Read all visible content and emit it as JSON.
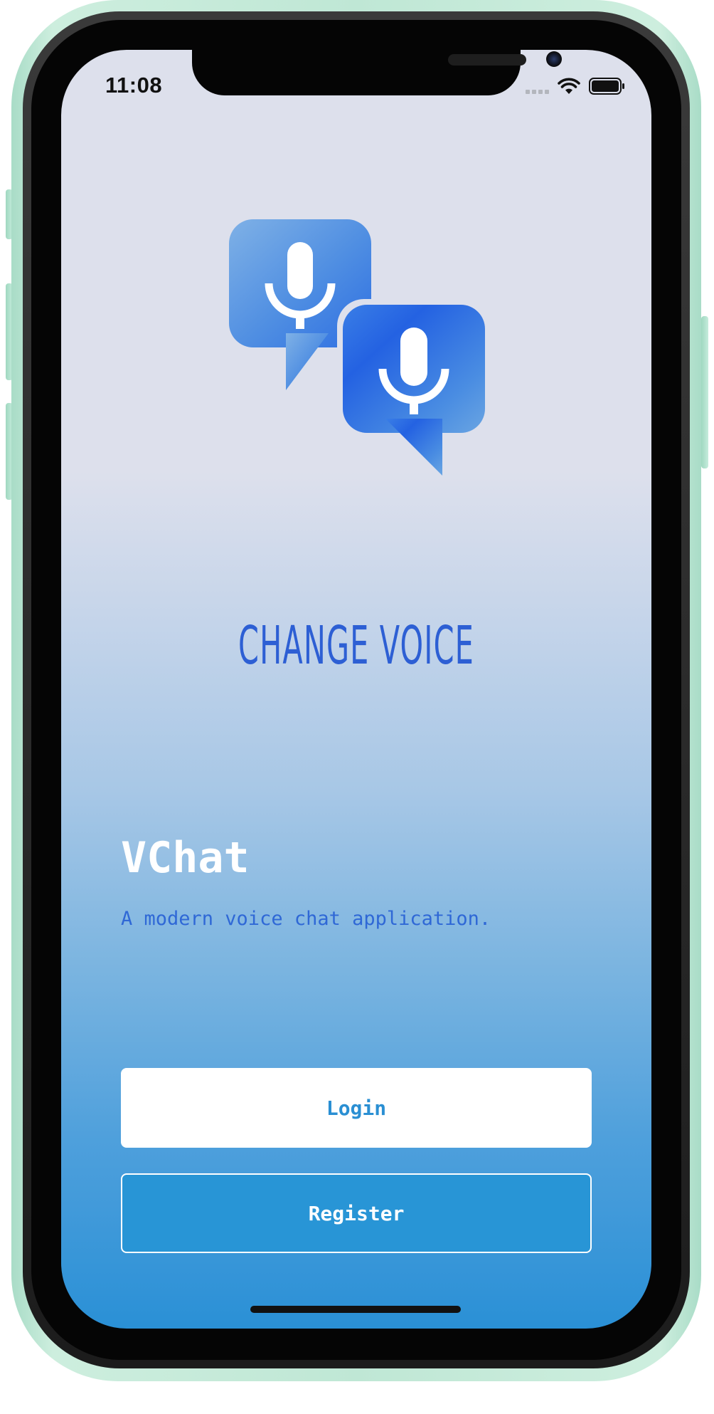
{
  "status_bar": {
    "time": "11:08",
    "icons": [
      "cellular-signal-icon",
      "wifi-icon",
      "battery-icon"
    ]
  },
  "logo": {
    "icon": "voice-chat-bubbles-icon",
    "colors": {
      "bubble_light": "#6aa3e6",
      "bubble_dark": "#2462e2",
      "mic": "#ffffff"
    }
  },
  "brand": {
    "title": "CHANGE VOICE",
    "color": "#2d5fd4"
  },
  "app": {
    "name": "VChat",
    "tagline": "A modern voice chat application."
  },
  "actions": {
    "login_label": "Login",
    "register_label": "Register"
  },
  "theme": {
    "background_top": "#dde0ec",
    "background_bottom": "#2a90d6",
    "accent": "#2895d6",
    "frame": "#bfe7d5"
  }
}
